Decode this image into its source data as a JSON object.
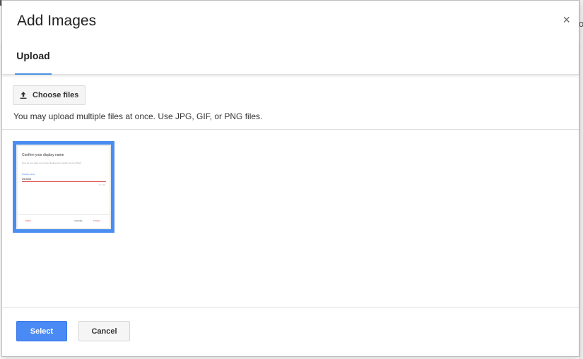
{
  "dialog": {
    "title": "Add Images",
    "close_glyph": "×"
  },
  "tabs": [
    {
      "label": "Upload",
      "active": true
    }
  ],
  "upload": {
    "choose_label": "Choose files",
    "hint": "You may upload multiple files at once. Use JPG, GIF, or PNG files."
  },
  "thumbnail": {
    "selected": true,
    "preview": {
      "title": "Confirm your display name",
      "subtitle": "How do you want your name displayed to readers of your blog?",
      "field_label": "Display name",
      "field_value": "Dewilot",
      "counter": "8 / 100",
      "prev": "PREV",
      "cancel": "CANCEL",
      "finish": "FINISH"
    }
  },
  "footer": {
    "select_label": "Select",
    "cancel_label": "Cancel"
  },
  "colors": {
    "accent": "#4a8af4",
    "selection_border": "#4a8df0",
    "tab_underline": "#4a90e2"
  },
  "icons": {
    "close": "close-icon",
    "upload": "upload-icon"
  }
}
